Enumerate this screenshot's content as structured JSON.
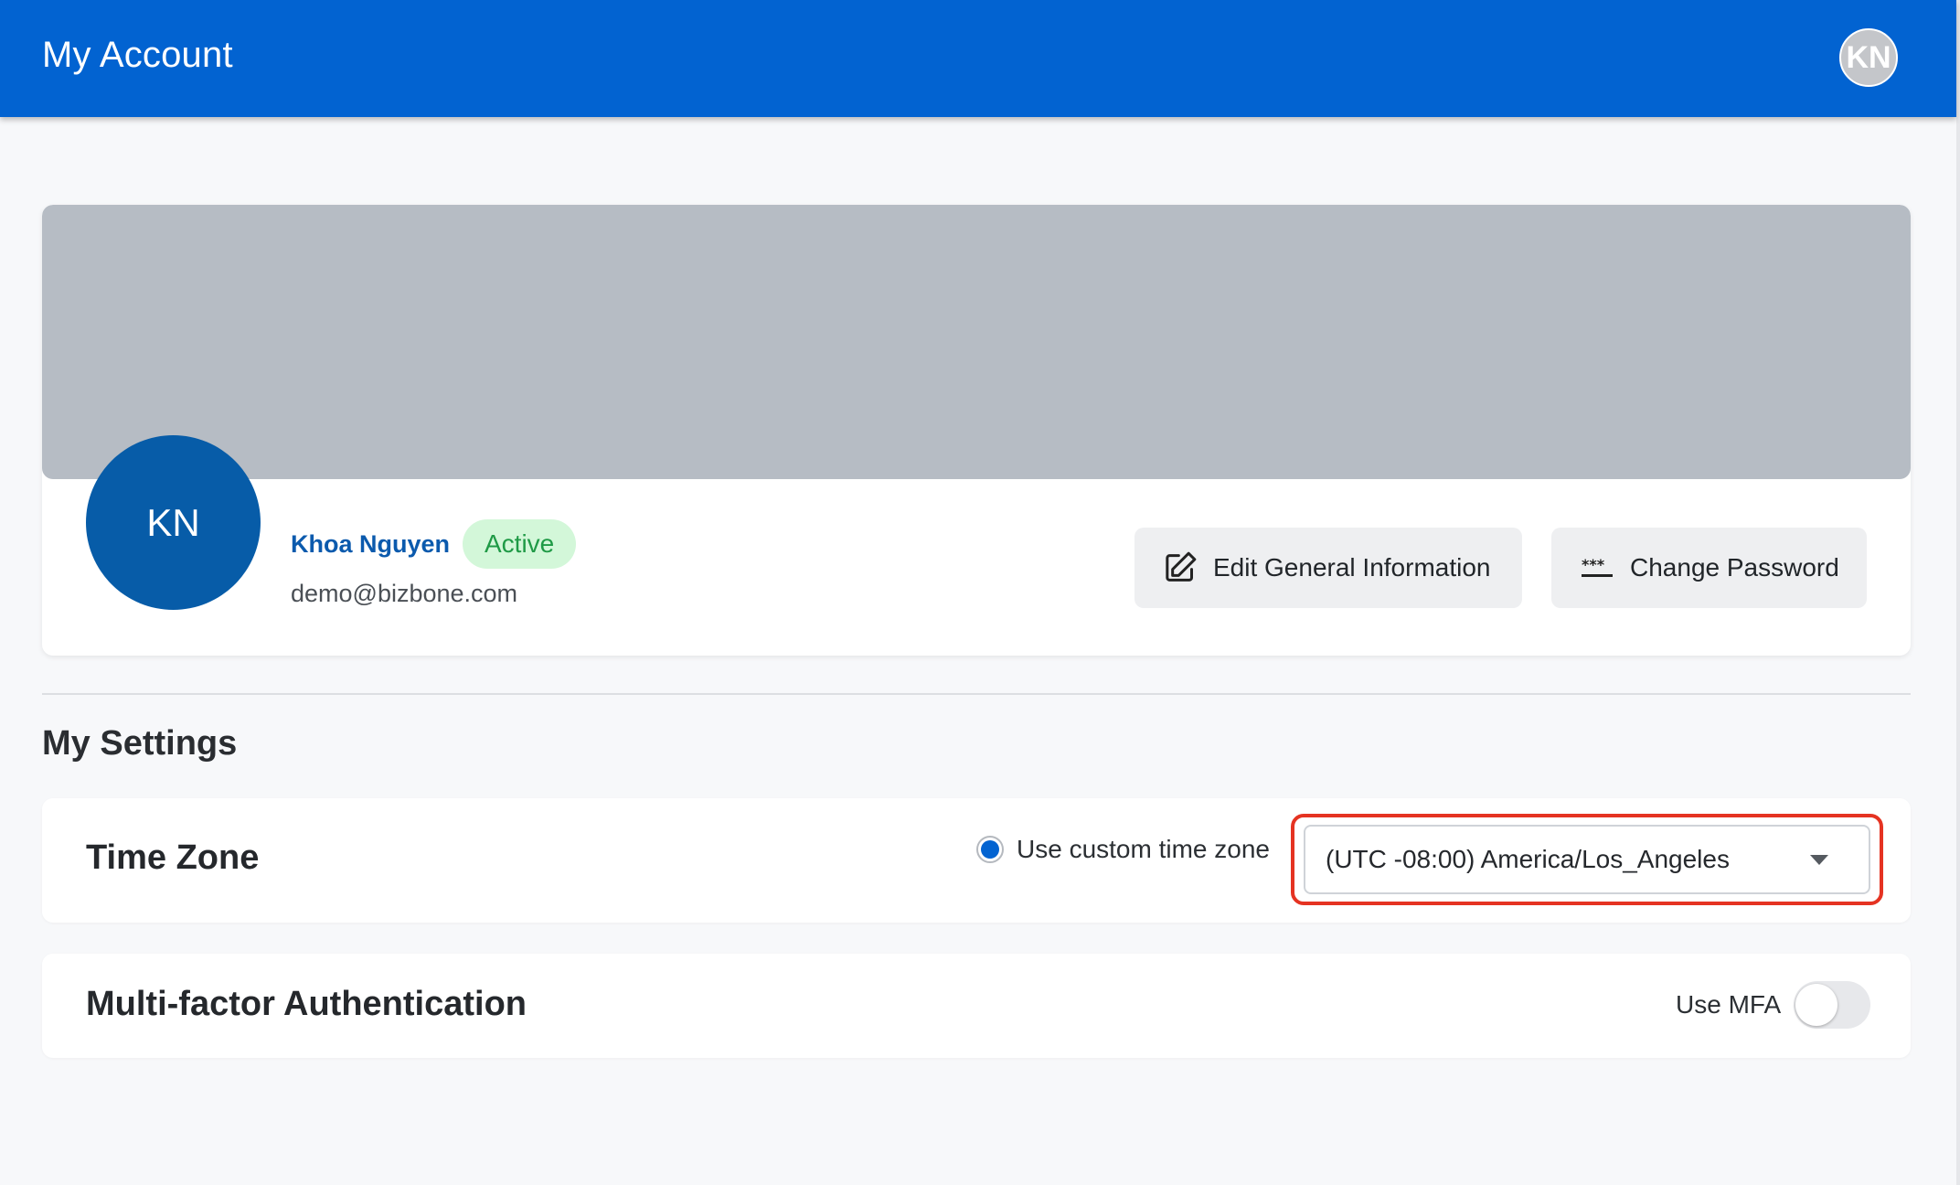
{
  "header": {
    "title": "My Account",
    "avatar_initials": "KN"
  },
  "profile": {
    "avatar_initials": "KN",
    "name": "Khoa Nguyen",
    "status": "Active",
    "email": "demo@bizbone.com",
    "edit_button_label": "Edit General Information",
    "password_button_label": "Change Password",
    "password_icon_glyph": "***"
  },
  "settings": {
    "heading": "My Settings",
    "time_zone": {
      "title": "Time Zone",
      "radio_label": "Use custom time zone",
      "radio_selected": true,
      "selected_value": "(UTC -08:00) America/Los_Angeles"
    },
    "mfa": {
      "title": "Multi-factor Authentication",
      "toggle_label": "Use MFA",
      "enabled": false
    }
  },
  "colors": {
    "header_bg": "#0263d1",
    "profile_avatar_bg": "#075ca8",
    "status_badge_bg": "#d3f7d9",
    "status_badge_text": "#1f9a46",
    "highlight_border": "#e53322"
  }
}
